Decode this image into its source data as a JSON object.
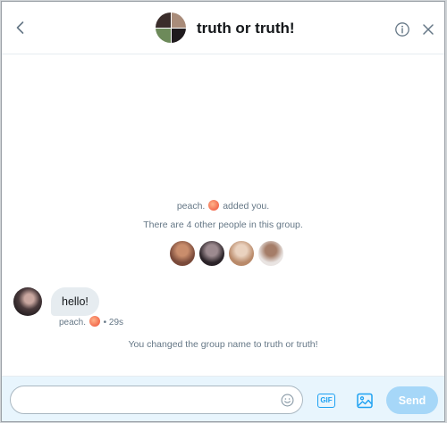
{
  "header": {
    "title": "truth or truth!",
    "back_icon": "chevron-left-icon",
    "info_icon": "info-icon",
    "close_icon": "close-icon"
  },
  "conversation": {
    "added_prefix": "peach.",
    "added_suffix": "added you.",
    "member_count_text": "There are 4 other people in this group.",
    "members": [
      {
        "color_a": "#7a4a3a",
        "color_b": "#c98d6c"
      },
      {
        "color_a": "#2b2328",
        "color_b": "#9c8a8f"
      },
      {
        "color_a": "#b98a6a",
        "color_b": "#ead2bf"
      },
      {
        "color_a": "#e9e4e2",
        "color_b": "#a57d68"
      }
    ],
    "message": {
      "text": "hello!",
      "sender": "peach.",
      "time": "29s"
    },
    "rename_notice": "You changed the group name to truth or truth!"
  },
  "compose": {
    "input_value": "",
    "input_placeholder": "",
    "gif_label": "GIF",
    "send_label": "Send"
  },
  "colors": {
    "accent": "#1da1f2",
    "send_disabled": "#a6d7f8",
    "compose_bg": "#e8f5fd"
  }
}
